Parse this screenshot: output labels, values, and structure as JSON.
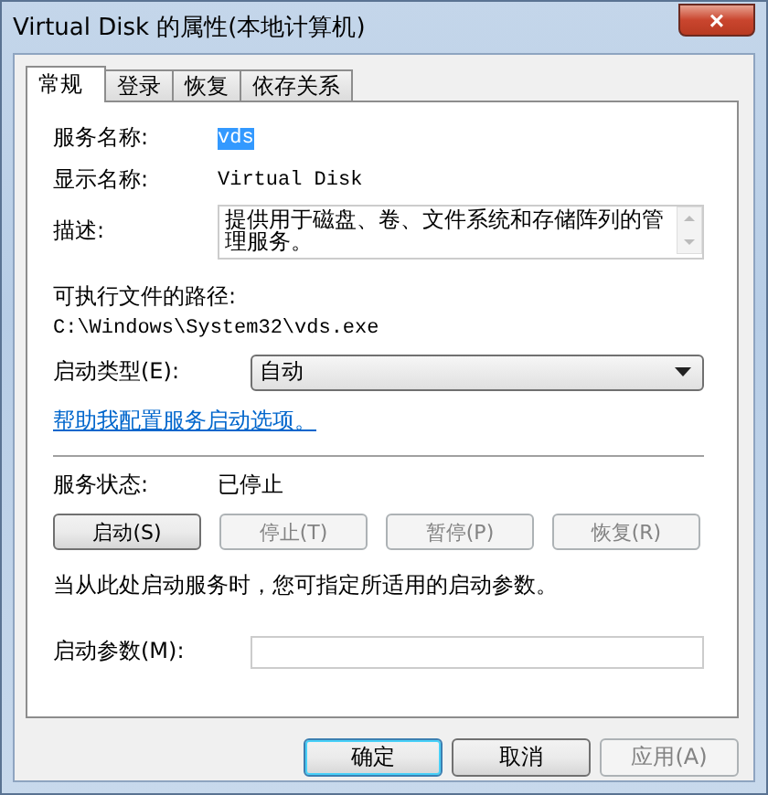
{
  "window": {
    "title": "Virtual Disk 的属性(本地计算机)",
    "close": "×"
  },
  "tabs": [
    {
      "label": "常规",
      "selected": true
    },
    {
      "label": "登录",
      "selected": false
    },
    {
      "label": "恢复",
      "selected": false
    },
    {
      "label": "依存关系",
      "selected": false
    }
  ],
  "service_name": {
    "label": "服务名称:",
    "value": "vds",
    "selected": true
  },
  "display_name": {
    "label": "显示名称:",
    "value": "Virtual Disk"
  },
  "description": {
    "label": "描述:",
    "value": "提供用于磁盘、卷、文件系统和存储阵列的管理服务。"
  },
  "path": {
    "label": "可执行文件的路径:",
    "value": "C:\\Windows\\System32\\vds.exe"
  },
  "startup_type": {
    "label": "启动类型(E):",
    "value": "自动"
  },
  "help_link": "帮助我配置服务启动选项。",
  "service_status": {
    "label": "服务状态:",
    "value": "已停止"
  },
  "service_buttons": [
    {
      "label": "启动(S)",
      "disabled": false
    },
    {
      "label": "停止(T)",
      "disabled": true
    },
    {
      "label": "暂停(P)",
      "disabled": true
    },
    {
      "label": "恢复(R)",
      "disabled": true
    }
  ],
  "hint": "当从此处启动服务时，您可指定所适用的启动参数。",
  "start_params": {
    "label": "启动参数(M):"
  },
  "dialog_buttons": [
    {
      "label": "确定",
      "disabled": false,
      "default": true
    },
    {
      "label": "取消",
      "disabled": false,
      "default": false
    },
    {
      "label": "应用(A)",
      "disabled": true,
      "default": false
    }
  ]
}
